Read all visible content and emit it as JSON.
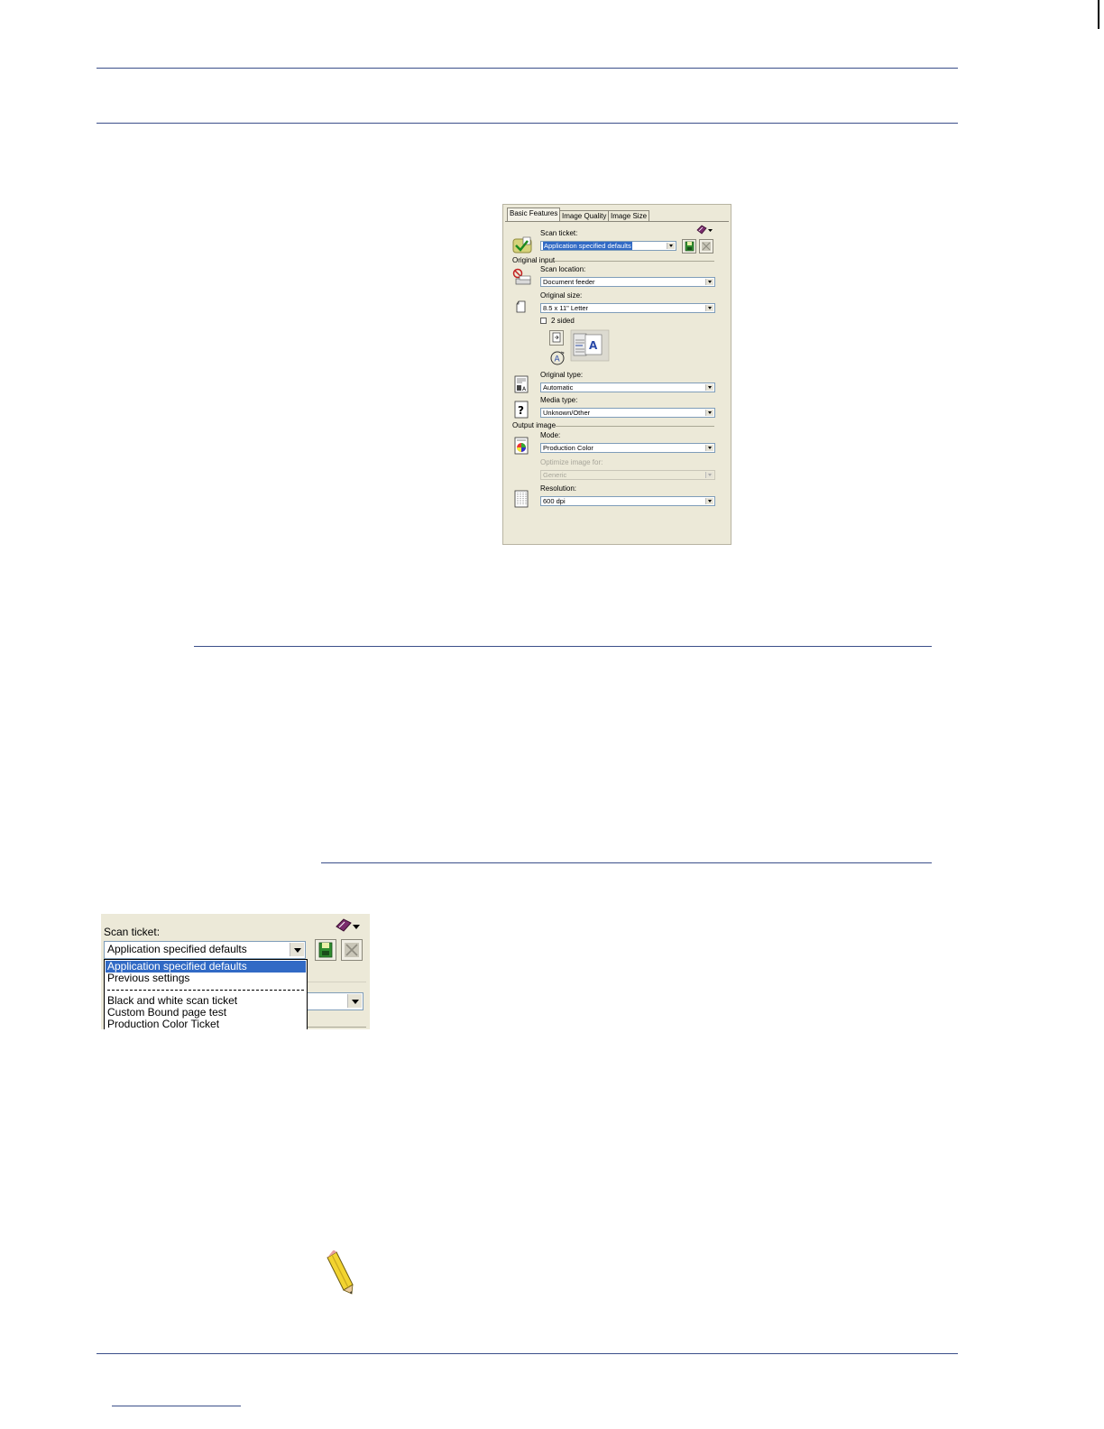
{
  "dialog": {
    "tabs": [
      "Basic Features",
      "Image Quality",
      "Image Size"
    ],
    "scan_ticket": {
      "label": "Scan ticket:",
      "value": "Application specified defaults"
    },
    "original_input": {
      "group_label": "Original input",
      "scan_location": {
        "label": "Scan location:",
        "value": "Document feeder"
      },
      "original_size": {
        "label": "Original size:",
        "value": "8.5 x 11\" Letter"
      },
      "two_sided": {
        "label": "2 sided",
        "checked": false
      },
      "original_type": {
        "label": "Original type:",
        "value": "Automatic"
      },
      "media_type": {
        "label": "Media type:",
        "value": "Unknown/Other"
      }
    },
    "output_image": {
      "group_label": "Output image",
      "mode": {
        "label": "Mode:",
        "value": "Production Color"
      },
      "optimize": {
        "label": "Optimize image for:",
        "value": "Generic",
        "disabled": true
      },
      "resolution": {
        "label": "Resolution:",
        "value": "600 dpi"
      }
    },
    "icons": {
      "menu": "book-menu-icon",
      "ticket": "scan-ticket-check-icon",
      "save": "save-disk-icon",
      "delete": "delete-x-icon",
      "location": "scan-location-icon",
      "size": "page-size-icon",
      "type": "original-type-icon",
      "media": "media-type-question-icon",
      "mode": "color-mode-icon",
      "resolution": "resolution-grid-icon"
    }
  },
  "zoom": {
    "label": "Scan ticket:",
    "value": "Application specified defaults",
    "options_top": [
      "Application specified defaults",
      "Previous settings"
    ],
    "options_bottom": [
      "Black and white scan ticket",
      "Custom Bound page test",
      "Production Color Ticket"
    ],
    "selected_index": 0
  },
  "colors": {
    "rule": "#3b4f8a",
    "dialog_bg": "#ece9d8",
    "highlight": "#316ac5"
  }
}
